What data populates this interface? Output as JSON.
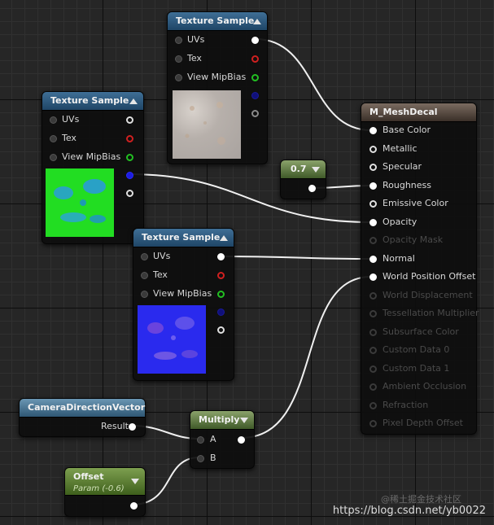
{
  "nodes": {
    "texture_sample_1": {
      "title": "Texture Sample",
      "inputs": {
        "uvs": "UVs",
        "tex": "Tex",
        "mip": "View MipBias"
      }
    },
    "texture_sample_2": {
      "title": "Texture Sample",
      "inputs": {
        "uvs": "UVs",
        "tex": "Tex",
        "mip": "View MipBias"
      }
    },
    "texture_sample_3": {
      "title": "Texture Sample",
      "inputs": {
        "uvs": "UVs",
        "tex": "Tex",
        "mip": "View MipBias"
      }
    },
    "constant": {
      "value": "0.7"
    },
    "material": {
      "title": "M_MeshDecal",
      "pins": [
        {
          "label": "Base Color",
          "active": true
        },
        {
          "label": "Metallic",
          "active": true
        },
        {
          "label": "Specular",
          "active": true
        },
        {
          "label": "Roughness",
          "active": true
        },
        {
          "label": "Emissive Color",
          "active": true
        },
        {
          "label": "Opacity",
          "active": true
        },
        {
          "label": "Opacity Mask",
          "active": false
        },
        {
          "label": "Normal",
          "active": true
        },
        {
          "label": "World Position Offset",
          "active": true
        },
        {
          "label": "World Displacement",
          "active": false
        },
        {
          "label": "Tessellation Multiplier",
          "active": false
        },
        {
          "label": "Subsurface Color",
          "active": false
        },
        {
          "label": "Custom Data 0",
          "active": false
        },
        {
          "label": "Custom Data 1",
          "active": false
        },
        {
          "label": "Ambient Occlusion",
          "active": false
        },
        {
          "label": "Refraction",
          "active": false
        },
        {
          "label": "Pixel Depth Offset",
          "active": false
        }
      ]
    },
    "camera_direction": {
      "title": "CameraDirectionVector",
      "output": "Result"
    },
    "multiply": {
      "title": "Multiply",
      "input_a": "A",
      "input_b": "B"
    },
    "offset": {
      "title": "Offset",
      "subtitle": "Param (-0.6)"
    }
  },
  "watermark": {
    "text": "https://blog.csdn.net/yb0022",
    "faint": "@稀土掘金技术社区"
  },
  "colors": {
    "texture_header": "#2f5a80",
    "material_header": "#5a4a40",
    "constant_header": "#5a7a3a",
    "grid": "#262626"
  }
}
